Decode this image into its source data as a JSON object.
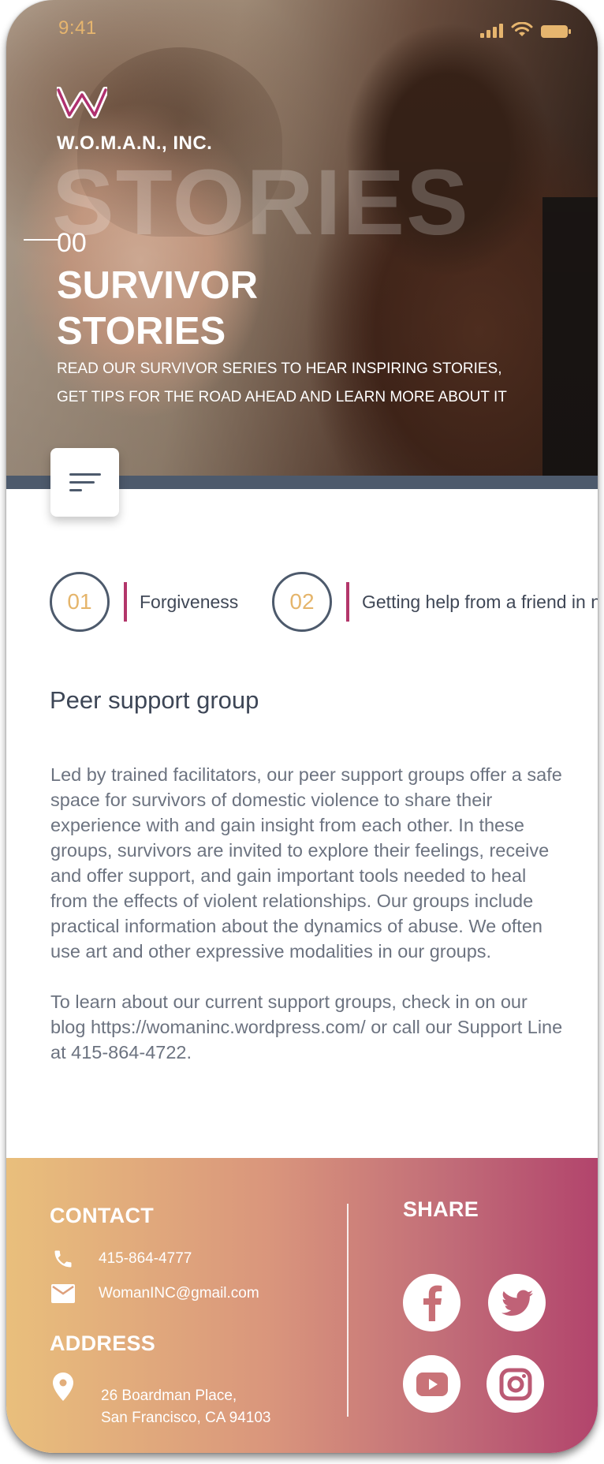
{
  "status_bar": {
    "time": "9:41"
  },
  "header": {
    "brand": "W.O.M.A.N., INC.",
    "ghost_word": "STORIES",
    "index": "00",
    "title_line1": "SURVIVOR",
    "title_line2": "STORIES",
    "subtitle": "READ OUR SURVIVOR SERIES TO HEAR INSPIRING STORIES, GET TIPS FOR THE ROAD AHEAD AND LEARN MORE ABOUT IT"
  },
  "stories": [
    {
      "number": "01",
      "label": "Forgiveness"
    },
    {
      "number": "02",
      "label": "Getting help from a friend in need"
    }
  ],
  "content": {
    "title": "Peer support group",
    "paragraphs": [
      "Led by trained facilitators, our peer support groups offer a safe space for survivors of domestic violence to share their experience with and gain insight from each other. In these groups, survivors are invited to explore their feelings, receive and offer support, and gain important tools needed to heal from the effects of violent relationships. Our groups include practical information about the dynamics of abuse. We often use art and other expressive modalities in our groups.",
      "To learn about our current support groups, check in on our blog https://womaninc.wordpress.com/ or call our Support Line at 415-864-4722."
    ]
  },
  "footer": {
    "contact_heading": "CONTACT",
    "phone": "415-864-4777",
    "email": "WomanINC@gmail.com",
    "address_heading": "ADDRESS",
    "address_line1": "26 Boardman Place,",
    "address_line2": "San Francisco, CA 94103",
    "share_heading": "SHARE",
    "social": [
      "facebook-icon",
      "twitter-icon",
      "youtube-icon",
      "instagram-icon"
    ]
  },
  "colors": {
    "accent_gold": "#e5b56b",
    "accent_magenta": "#b3366a",
    "slate": "#4d5a6c",
    "footer_gradient_start": "#e9bf7c",
    "footer_gradient_end": "#b2446c"
  }
}
